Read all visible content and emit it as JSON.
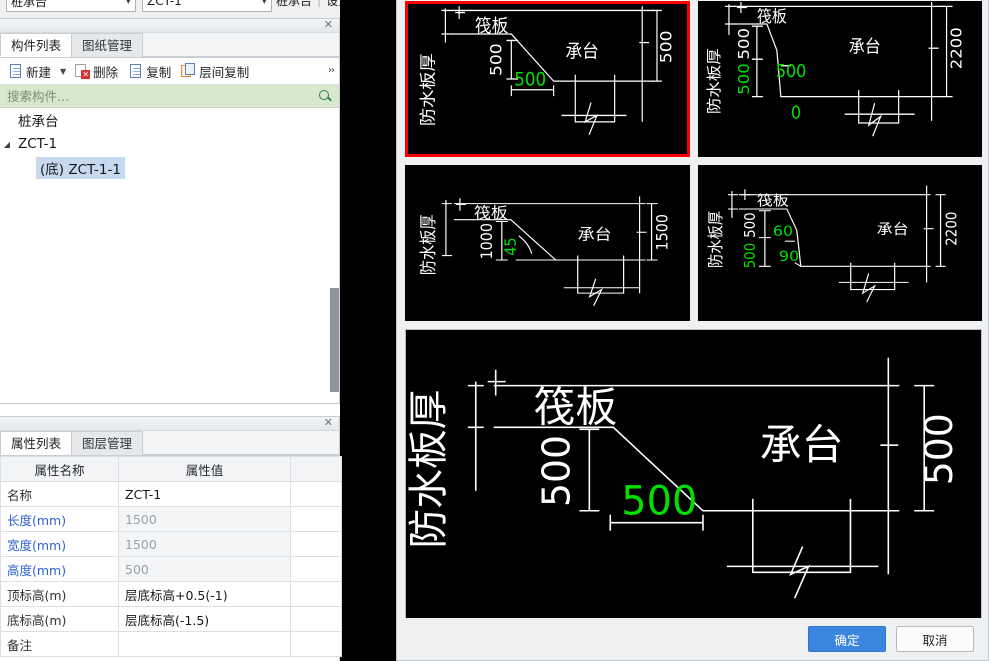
{
  "ribbon": {
    "component_type": "桩承台",
    "component_name": "ZCT-1",
    "tail_label": "桩承台",
    "tail_sep": "|",
    "tail_label2": "设置边坡",
    "dropdown_icon": "chevron-down-icon"
  },
  "component_panel": {
    "close_icon": "close-icon",
    "tabs": [
      {
        "label": "构件列表",
        "active": true
      },
      {
        "label": "图纸管理",
        "active": false
      }
    ],
    "toolbar": {
      "new_label": "新建",
      "new_caret": "chevron-down-icon",
      "delete_label": "删除",
      "copy_label": "复制",
      "floor_copy_label": "层间复制",
      "overflow_label": "››"
    },
    "search": {
      "placeholder": "搜索构件...",
      "value": "",
      "icon": "search-icon"
    },
    "tree": [
      {
        "level": 0,
        "twisty": "",
        "label": "桩承台",
        "selected": false
      },
      {
        "level": 1,
        "twisty": "◢",
        "label": "ZCT-1",
        "selected": false
      },
      {
        "level": 2,
        "twisty": "",
        "label": "(底) ZCT-1-1",
        "selected": true
      }
    ]
  },
  "property_panel": {
    "close_icon": "close-icon",
    "tabs": [
      {
        "label": "属性列表",
        "active": true
      },
      {
        "label": "图层管理",
        "active": false
      }
    ],
    "headers": [
      "属性名称",
      "属性值",
      ""
    ],
    "rows": [
      {
        "name": "名称",
        "name_blue": false,
        "value": "ZCT-1",
        "readonly": false
      },
      {
        "name": "长度(mm)",
        "name_blue": true,
        "value": "1500",
        "readonly": true
      },
      {
        "name": "宽度(mm)",
        "name_blue": true,
        "value": "1500",
        "readonly": true
      },
      {
        "name": "高度(mm)",
        "name_blue": true,
        "value": "500",
        "readonly": true
      },
      {
        "name": "顶标高(m)",
        "name_blue": false,
        "value": "层底标高+0.5(-1)",
        "readonly": false
      },
      {
        "name": "底标高(m)",
        "name_blue": false,
        "value": "层底标高(-1.5)",
        "readonly": false
      },
      {
        "name": "备注",
        "name_blue": false,
        "value": "",
        "readonly": false
      }
    ]
  },
  "dialog": {
    "selected_index": 0,
    "buttons": {
      "confirm": "确定",
      "cancel": "取消"
    },
    "thumbnails": [
      {
        "id": "slope-500-500",
        "selected": true,
        "labels": {
          "left_vertical": "防水板厚",
          "top": "筏板",
          "body": "承台",
          "dim_vertical_white": "500",
          "dim_horizontal_green": "500",
          "dim_right": "500"
        }
      },
      {
        "id": "slope-500-500-0",
        "selected": false,
        "labels": {
          "left_vertical": "防水板厚",
          "top": "筏板",
          "body": "承台",
          "dim_v1_white": "500",
          "dim_v2_green": "500",
          "dim_mid_green": "500",
          "dim_bottom_green": "0",
          "dim_right": "2200"
        }
      },
      {
        "id": "slope-1000-45",
        "selected": false,
        "labels": {
          "left_vertical": "防水板厚",
          "top": "筏板",
          "body": "承台",
          "dim_vertical_white": "1000",
          "angle_green": "45",
          "dim_right": "1500"
        }
      },
      {
        "id": "slope-500-60-90",
        "selected": false,
        "labels": {
          "left_vertical": "防水板厚",
          "top": "筏板",
          "body": "承台",
          "dim_v1_white": "500",
          "dim_v2_green": "500",
          "angle1_green": "60",
          "angle2_green": "90",
          "dim_right": "2200"
        }
      }
    ],
    "preview": {
      "left_vertical": "防水板厚",
      "top": "筏板",
      "body": "承台",
      "dim_vertical_white": "500",
      "dim_horizontal_green": "500",
      "dim_right": "500"
    }
  }
}
